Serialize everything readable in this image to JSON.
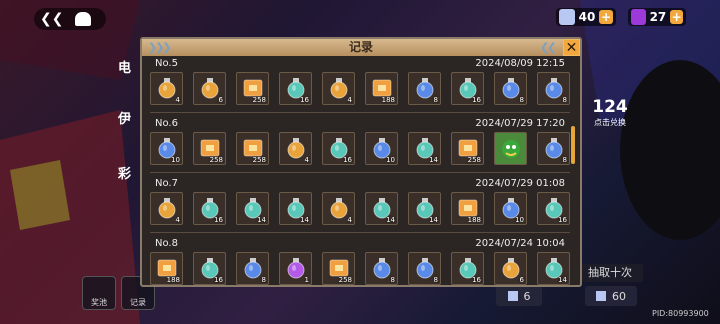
{
  "top": {
    "back_icon": "back-chevron-icon",
    "currencies": [
      {
        "value": "40",
        "color": "#b9c8f2"
      },
      {
        "value": "27",
        "color": "#9b3ad8"
      }
    ]
  },
  "side": {
    "labels": [
      "电",
      "伊",
      "彩"
    ],
    "right_count": "124",
    "right_count_label": "点击兑换",
    "bottom_buttons": [
      {
        "label": "奖池"
      },
      {
        "label": "记录"
      }
    ],
    "cost_left": "6",
    "cost_right": "60",
    "draw_ten": "抽取十次",
    "pid": "PID:80993900"
  },
  "dialog": {
    "title": "记录",
    "records": [
      {
        "no": "No.5",
        "date": "2024/08/09 12:15",
        "items": [
          {
            "type": "gold-potion",
            "qty": "4"
          },
          {
            "type": "gold-potion",
            "qty": "6"
          },
          {
            "type": "coin-box",
            "qty": "258"
          },
          {
            "type": "teal-potion",
            "qty": "16"
          },
          {
            "type": "gold-potion",
            "qty": "4"
          },
          {
            "type": "coin-box",
            "qty": "188"
          },
          {
            "type": "blue-potion",
            "qty": "8"
          },
          {
            "type": "teal-potion",
            "qty": "16"
          },
          {
            "type": "blue-potion",
            "qty": "8"
          },
          {
            "type": "blue-potion",
            "qty": "8"
          }
        ]
      },
      {
        "no": "No.6",
        "date": "2024/07/29 17:20",
        "items": [
          {
            "type": "blue-potion",
            "qty": "10"
          },
          {
            "type": "coin-box",
            "qty": "258"
          },
          {
            "type": "coin-box",
            "qty": "258"
          },
          {
            "type": "gold-potion",
            "qty": "4"
          },
          {
            "type": "teal-potion",
            "qty": "16"
          },
          {
            "type": "blue-potion",
            "qty": "10"
          },
          {
            "type": "teal-potion",
            "qty": "14"
          },
          {
            "type": "coin-box",
            "qty": "258"
          },
          {
            "type": "dragon-card",
            "qty": ""
          },
          {
            "type": "blue-potion",
            "qty": "8"
          }
        ]
      },
      {
        "no": "No.7",
        "date": "2024/07/29 01:08",
        "items": [
          {
            "type": "gold-potion",
            "qty": "4"
          },
          {
            "type": "teal-potion",
            "qty": "16"
          },
          {
            "type": "teal-potion",
            "qty": "14"
          },
          {
            "type": "teal-potion",
            "qty": "14"
          },
          {
            "type": "gold-potion",
            "qty": "4"
          },
          {
            "type": "teal-potion",
            "qty": "14"
          },
          {
            "type": "teal-potion",
            "qty": "14"
          },
          {
            "type": "coin-box",
            "qty": "188"
          },
          {
            "type": "blue-potion",
            "qty": "10"
          },
          {
            "type": "teal-potion",
            "qty": "16"
          }
        ]
      },
      {
        "no": "No.8",
        "date": "2024/07/24 10:04",
        "items": [
          {
            "type": "coin-box",
            "qty": "188"
          },
          {
            "type": "teal-potion",
            "qty": "16"
          },
          {
            "type": "blue-potion",
            "qty": "8"
          },
          {
            "type": "purple-potion",
            "qty": "1"
          },
          {
            "type": "coin-box",
            "qty": "258"
          },
          {
            "type": "blue-potion",
            "qty": "8"
          },
          {
            "type": "blue-potion",
            "qty": "8"
          },
          {
            "type": "teal-potion",
            "qty": "16"
          },
          {
            "type": "gold-potion",
            "qty": "6"
          },
          {
            "type": "teal-potion",
            "qty": "14"
          }
        ]
      }
    ]
  },
  "colors": {
    "gold-potion": "#e8a43a",
    "teal-potion": "#5ac8b8",
    "blue-potion": "#5a8ae8",
    "purple-potion": "#b45ae8",
    "coin-box": "#f0a040"
  }
}
